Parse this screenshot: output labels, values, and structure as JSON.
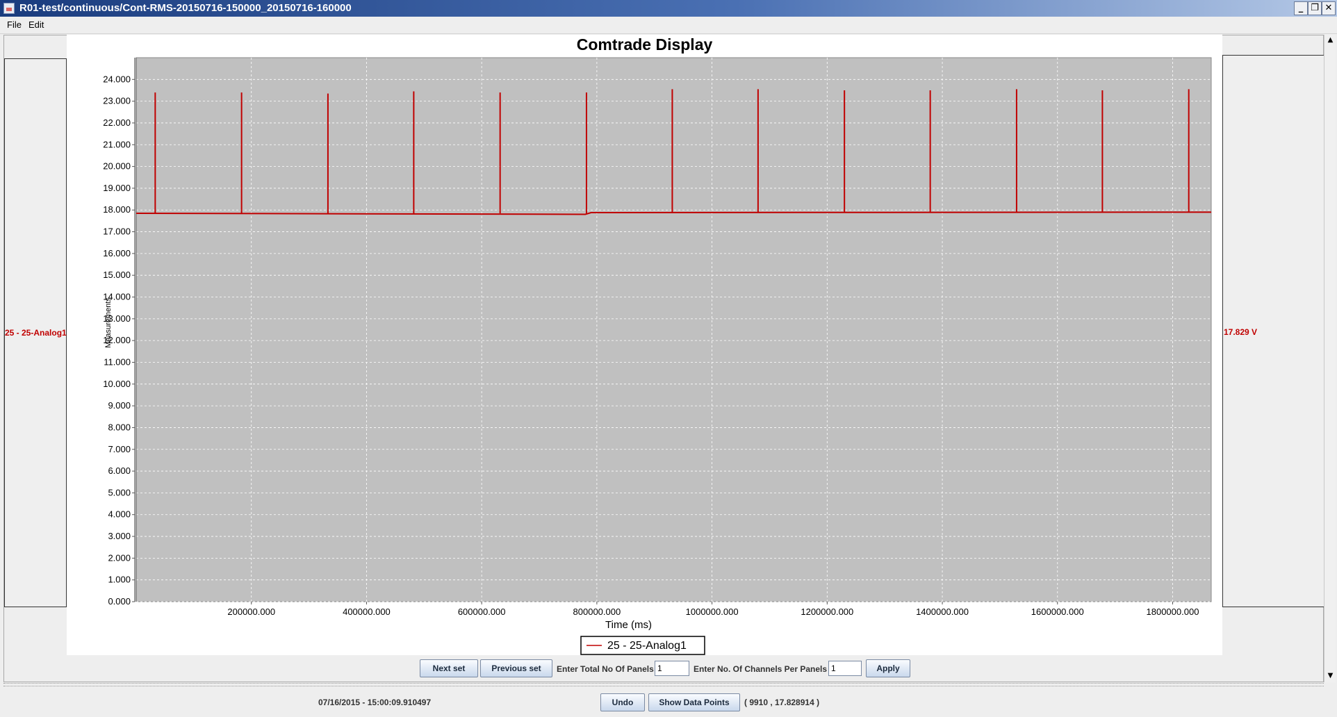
{
  "window": {
    "title": "R01-test/continuous/Cont-RMS-20150716-150000_20150716-160000",
    "min_glyph": "_",
    "restore_glyph": "❐",
    "close_glyph": "✕"
  },
  "menu": [
    {
      "label": "File"
    },
    {
      "label": "Edit"
    }
  ],
  "left_panel": {
    "channel_label": "25 - 25-Analog1"
  },
  "right_panel": {
    "value_label": "17.829 V"
  },
  "controls": {
    "next_set": "Next set",
    "previous_set": "Previous set",
    "total_panels_label": "Enter Total No Of Panels",
    "total_panels_value": "1",
    "channels_per_panel_label": "Enter No. Of Channels Per Panels",
    "channels_per_panel_value": "1",
    "apply": "Apply"
  },
  "status": {
    "timestamp": "07/16/2015 - 15:00:09.910497",
    "undo": "Undo",
    "show_data_points": "Show Data Points",
    "coordinate": "( 9910 , 17.828914 )"
  },
  "scroll": {
    "up_glyph": "▲",
    "down_glyph": "▼"
  },
  "chart_data": {
    "type": "line",
    "title": "Comtrade Display",
    "xlabel": "Time (ms)",
    "ylabel": "Measurements",
    "xlim": [
      0,
      1867000
    ],
    "ylim": [
      0,
      25.0
    ],
    "x_tick_values": [
      200000,
      400000,
      600000,
      800000,
      1000000,
      1200000,
      1400000,
      1600000,
      1800000
    ],
    "x_tick_labels": [
      "200000.000",
      "400000.000",
      "600000.000",
      "800000.000",
      "1000000.000",
      "1200000.000",
      "1400000.000",
      "1600000.000",
      "1800000.000"
    ],
    "y_tick_values": [
      0,
      1,
      2,
      3,
      4,
      5,
      6,
      7,
      8,
      9,
      10,
      11,
      12,
      13,
      14,
      15,
      16,
      17,
      18,
      19,
      20,
      21,
      22,
      23,
      24
    ],
    "y_tick_labels": [
      "0.000",
      "1.000",
      "2.000",
      "3.000",
      "4.000",
      "5.000",
      "6.000",
      "7.000",
      "8.000",
      "9.000",
      "10.000",
      "11.000",
      "12.000",
      "13.000",
      "14.000",
      "15.000",
      "16.000",
      "17.000",
      "18.000",
      "19.000",
      "20.000",
      "21.000",
      "22.000",
      "23.000",
      "24.000"
    ],
    "grid": true,
    "background_color": "#c0c0c0",
    "legend_position": "bottom-center",
    "series": [
      {
        "name": "25 - 25-Analog1",
        "color": "#c00000",
        "baseline": [
          [
            0,
            17.85
          ],
          [
            780000,
            17.8
          ],
          [
            790000,
            17.88
          ],
          [
            1867000,
            17.9
          ]
        ],
        "spikes": [
          {
            "x": 33000,
            "y": 23.4
          },
          {
            "x": 183000,
            "y": 23.4
          },
          {
            "x": 333000,
            "y": 23.35
          },
          {
            "x": 482000,
            "y": 23.45
          },
          {
            "x": 632000,
            "y": 23.4
          },
          {
            "x": 782000,
            "y": 23.4
          },
          {
            "x": 931000,
            "y": 23.55
          },
          {
            "x": 1080000,
            "y": 23.55
          },
          {
            "x": 1230000,
            "y": 23.5
          },
          {
            "x": 1379000,
            "y": 23.5
          },
          {
            "x": 1529000,
            "y": 23.55
          },
          {
            "x": 1678000,
            "y": 23.5
          },
          {
            "x": 1828000,
            "y": 23.55
          }
        ]
      }
    ]
  }
}
